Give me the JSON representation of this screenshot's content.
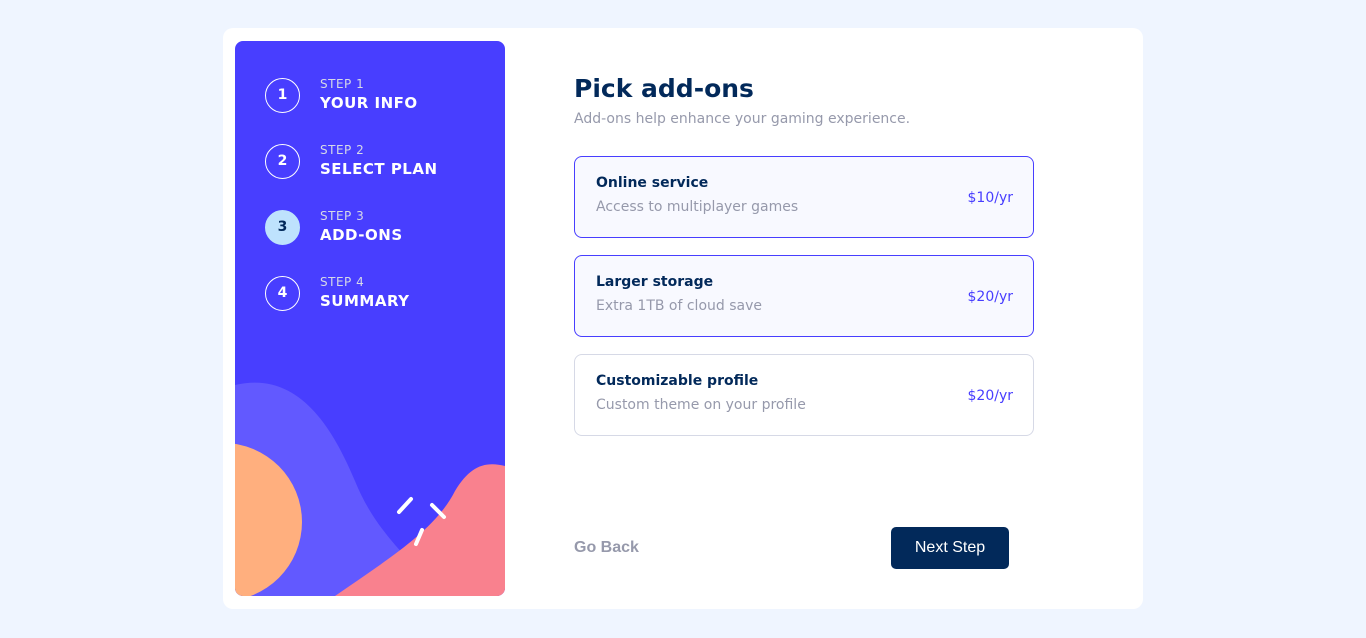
{
  "sidebar": {
    "steps": [
      {
        "number": "1",
        "caption": "STEP 1",
        "title": "YOUR INFO"
      },
      {
        "number": "2",
        "caption": "STEP 2",
        "title": "SELECT PLAN"
      },
      {
        "number": "3",
        "caption": "STEP 3",
        "title": "ADD-ONS"
      },
      {
        "number": "4",
        "caption": "STEP 4",
        "title": "SUMMARY"
      }
    ],
    "active_step": 3
  },
  "main": {
    "title": "Pick add-ons",
    "subtitle": "Add-ons help enhance your gaming experience.",
    "addons": [
      {
        "name": "Online service",
        "description": "Access to multiplayer games",
        "price": "$10/yr",
        "selected": true
      },
      {
        "name": "Larger storage",
        "description": "Extra 1TB of cloud save",
        "price": "$20/yr",
        "selected": true
      },
      {
        "name": "Customizable profile",
        "description": "Custom theme on your profile",
        "price": "$20/yr",
        "selected": false
      }
    ],
    "go_back_label": "Go Back",
    "next_step_label": "Next Step"
  },
  "colors": {
    "sidebar_bg": "#483eff",
    "marine_blue": "#02295a",
    "accent_purple": "#483eff",
    "active_step_bg": "#bee2fd",
    "cool_gray": "#9699ab",
    "page_bg": "#eff5ff"
  }
}
